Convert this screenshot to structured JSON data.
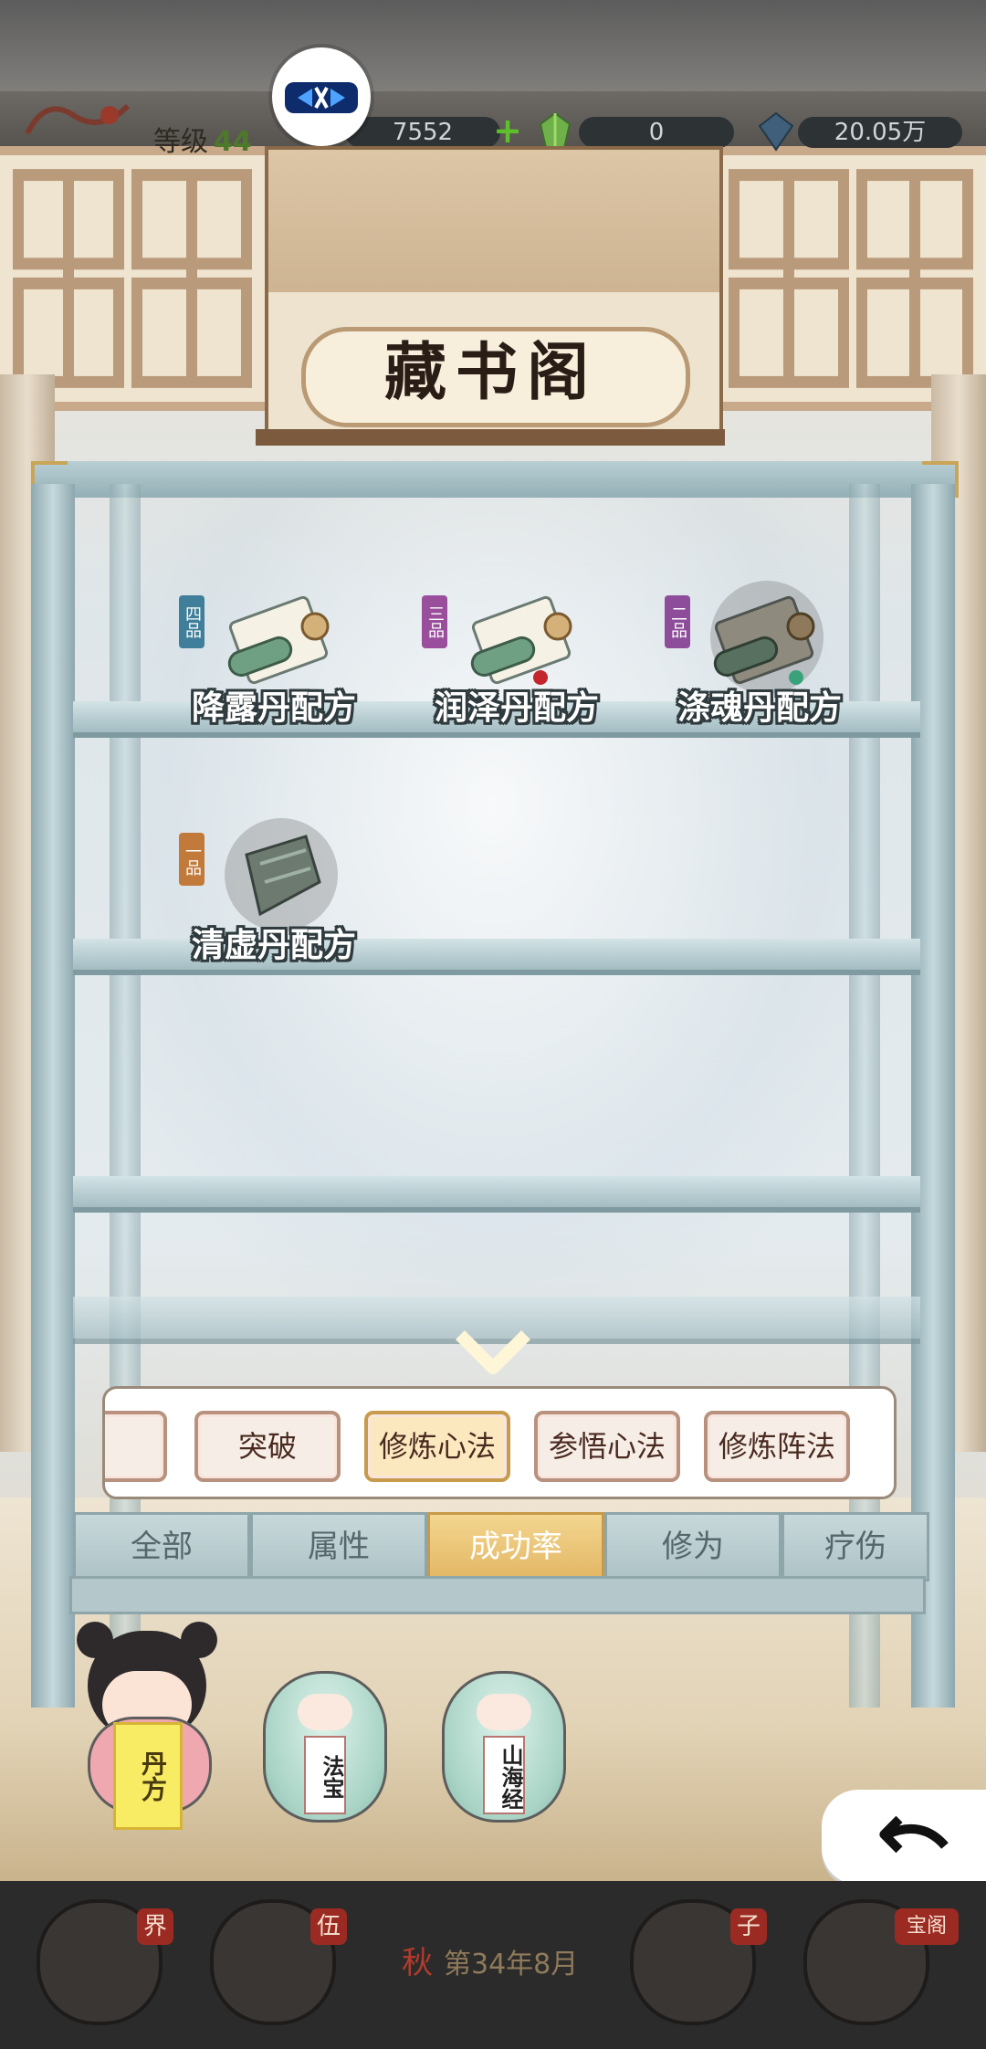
{
  "status": {
    "level_label": "等级",
    "level_value": "44",
    "copper": "7552",
    "spirit_stones": "0",
    "crystals": "20.05万"
  },
  "title": "藏书阁",
  "items": [
    {
      "name": "降露丹配方",
      "grade": "四品",
      "grade_color": "#3f7f9a",
      "locked": false
    },
    {
      "name": "润泽丹配方",
      "grade": "三品",
      "grade_color": "#9a4f9c",
      "locked": false
    },
    {
      "name": "涤魂丹配方",
      "grade": "二品",
      "grade_color": "#8d4d9a",
      "locked": true
    },
    {
      "name": "清虚丹配方",
      "grade": "一品",
      "grade_color": "#c27a3b",
      "locked": true
    }
  ],
  "category_tabs": [
    "突破",
    "修炼心法",
    "参悟心法",
    "修炼阵法"
  ],
  "category_active": "修炼心法",
  "sort_tabs": [
    "全部",
    "属性",
    "成功率",
    "修为",
    "疗伤"
  ],
  "sort_active": "成功率",
  "characters": [
    {
      "tag": "丹方"
    },
    {
      "tag": "法宝"
    },
    {
      "tag": "山海经"
    }
  ],
  "bottom_nav": [
    "界",
    "伍",
    "子",
    "宝阁"
  ],
  "date": {
    "season": "秋",
    "text": "第34年8月"
  }
}
